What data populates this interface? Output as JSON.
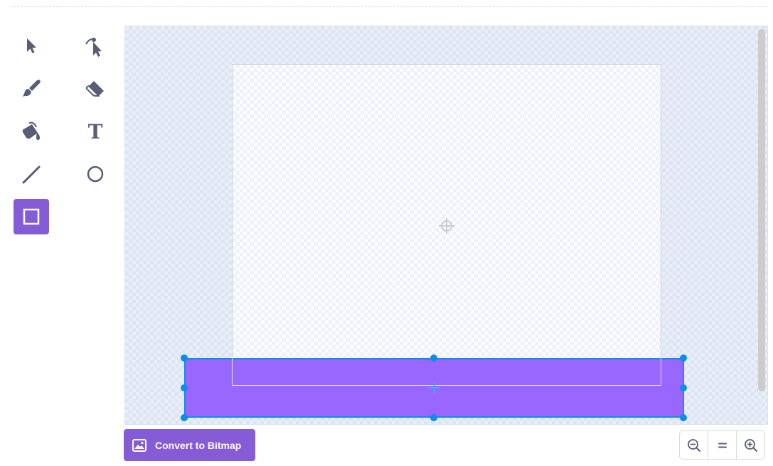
{
  "toolbar": {
    "tools": [
      {
        "name": "select",
        "icon": "select-arrow-icon",
        "selected": false
      },
      {
        "name": "reshape",
        "icon": "reshape-arrow-icon",
        "selected": false
      },
      {
        "name": "brush",
        "icon": "brush-icon",
        "selected": false
      },
      {
        "name": "eraser",
        "icon": "eraser-icon",
        "selected": false
      },
      {
        "name": "fill",
        "icon": "fill-bucket-icon",
        "selected": false
      },
      {
        "name": "text",
        "icon": "text-icon",
        "selected": false,
        "glyph": "T"
      },
      {
        "name": "line",
        "icon": "line-icon",
        "selected": false
      },
      {
        "name": "circle",
        "icon": "circle-icon",
        "selected": false
      },
      {
        "name": "rectangle",
        "icon": "rectangle-icon",
        "selected": true
      }
    ],
    "icon_color": "#575e75",
    "selected_color": "#855cd6"
  },
  "canvas": {
    "shape_fill": "#9966ff",
    "selection_color": "#0b8ee6"
  },
  "footer": {
    "convert_label": "Convert to Bitmap",
    "convert_icon": "image-icon",
    "zoom_out_icon": "zoom-out-icon",
    "zoom_reset_icon": "zoom-reset-icon",
    "zoom_in_icon": "zoom-in-icon"
  }
}
